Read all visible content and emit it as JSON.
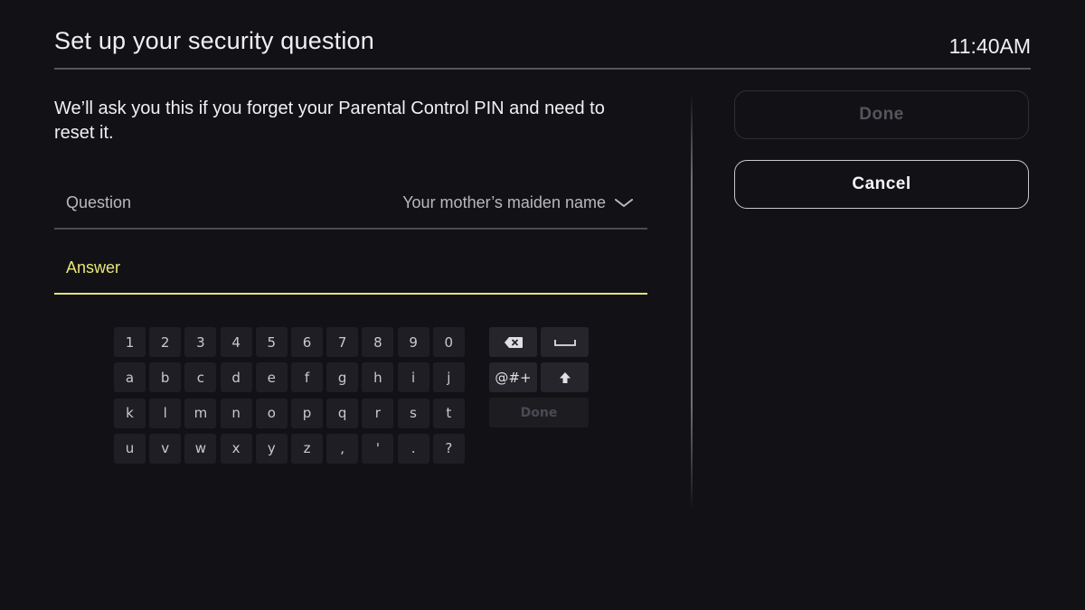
{
  "header": {
    "title": "Set up your security question",
    "clock": "11:40AM"
  },
  "description": "We’ll ask you this if you forget your Parental Control PIN and need to reset it.",
  "question_field": {
    "label": "Question",
    "value": "Your mother’s maiden name",
    "icon": "chevron-down-icon"
  },
  "answer_field": {
    "label": "Answer",
    "value": "",
    "focused": true,
    "focus_color": "#e6e377"
  },
  "keyboard": {
    "rows": [
      [
        "1",
        "2",
        "3",
        "4",
        "5",
        "6",
        "7",
        "8",
        "9",
        "0"
      ],
      [
        "a",
        "b",
        "c",
        "d",
        "e",
        "f",
        "g",
        "h",
        "i",
        "j"
      ],
      [
        "k",
        "l",
        "m",
        "n",
        "o",
        "p",
        "q",
        "r",
        "s",
        "t"
      ],
      [
        "u",
        "v",
        "w",
        "x",
        "y",
        "z",
        ",",
        "'",
        ".",
        "?"
      ]
    ],
    "backspace_icon": "backspace-icon",
    "space_icon": "space-icon",
    "symbols_label": "@#+",
    "shift_icon": "shift-icon",
    "done_label": "Done"
  },
  "actions": {
    "done_label": "Done",
    "done_enabled": false,
    "cancel_label": "Cancel"
  },
  "colors": {
    "background": "#121216",
    "accent_focus": "#e6e377",
    "text_primary": "#f0f0f2",
    "text_secondary": "#b8b8be"
  }
}
